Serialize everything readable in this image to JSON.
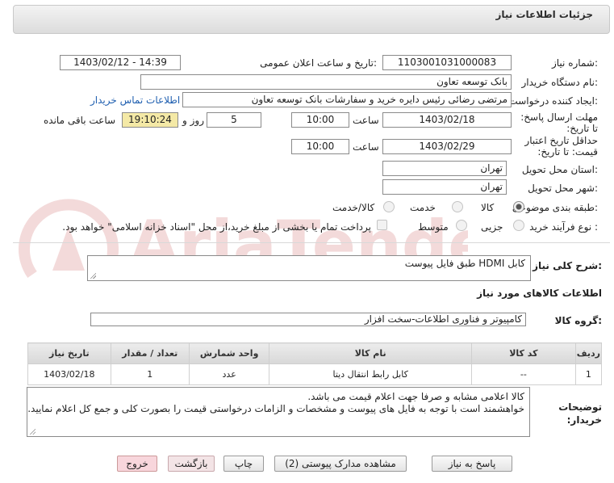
{
  "header": {
    "title": "جزئیات اطلاعات نیاز"
  },
  "form": {
    "need_number": {
      "label": "شماره نیاز:",
      "value": "1103001031000083"
    },
    "announce_datetime": {
      "label": "تاریخ و ساعت اعلان عمومی:",
      "value": "1403/02/12 - 14:39"
    },
    "buyer_org": {
      "label": "نام دستگاه خریدار:",
      "value": "بانک توسعه تعاون"
    },
    "requester": {
      "label": "ایجاد کننده درخواست:",
      "value": "مرتضی رضائی رئیس دایره خرید و سفارشات بانک توسعه تعاون"
    },
    "buyer_contact_link": "اطلاعات تماس خریدار",
    "reply_deadline": {
      "label": "مهلت ارسال پاسخ: تا تاریخ:",
      "date": "1403/02/18",
      "time_label": "ساعت",
      "time": "10:00",
      "days": "5",
      "days_label": "روز و",
      "remaining": "19:10:24",
      "remaining_label": "ساعت باقی مانده"
    },
    "price_validity": {
      "label": "حداقل تاریخ اعتبار قیمت: تا تاریخ:",
      "date": "1403/02/29",
      "time_label": "ساعت",
      "time": "10:00"
    },
    "delivery_province": {
      "label": "استان محل تحویل:",
      "value": "تهران"
    },
    "delivery_city": {
      "label": "شهر محل تحویل:",
      "value": "تهران"
    },
    "category": {
      "label": "طبقه بندی موضوعی:",
      "options": [
        "کالا",
        "خدمت",
        "کالا/خدمت"
      ],
      "selected": "کالا"
    },
    "process_type": {
      "label": "نوع فرآیند خرید :",
      "options": [
        "جزیی",
        "متوسط"
      ],
      "selected": "جزیی",
      "payment_note": "پرداخت تمام یا بخشی از مبلغ خرید،از محل \"اسناد خزانه اسلامی\" خواهد بود."
    }
  },
  "need_summary": {
    "label": "شرح کلی نیاز:",
    "value": "کابل HDMI طبق فایل پیوست"
  },
  "goods_info": {
    "title": "اطلاعات کالاهای مورد نیاز",
    "group_label": "گروه کالا:",
    "group_value": "کامپیوتر و فناوری اطلاعات-سخت افزار",
    "columns": [
      "ردیف",
      "کد کالا",
      "نام کالا",
      "واحد شمارش",
      "تعداد / مقدار",
      "تاریخ نیاز"
    ],
    "rows": [
      [
        "1",
        "--",
        "کابل رابط انتقال دیتا",
        "عدد",
        "1",
        "1403/02/18"
      ]
    ]
  },
  "buyer_notes": {
    "label": "توضیحات خریدار:",
    "line1": "کالا اعلامی مشابه و صرفا جهت اعلام قیمت می باشد.",
    "line2": "خواهشمند است با توجه به فایل های پیوست و مشخصات و الزامات درخواستی قیمت را بصورت کلی و جمع کل اعلام نمایید."
  },
  "buttons": {
    "reply": "پاسخ به نیاز",
    "view_docs": "مشاهده مدارک پیوستی (2)",
    "print": "چاپ",
    "back": "بازگشت",
    "exit": "خروج"
  },
  "watermark": "AriaTender.net",
  "colors": {
    "link": "#1f5fb0",
    "remaining_bg": "#f4e9a6",
    "exit_bg": "#f8d6dc"
  }
}
